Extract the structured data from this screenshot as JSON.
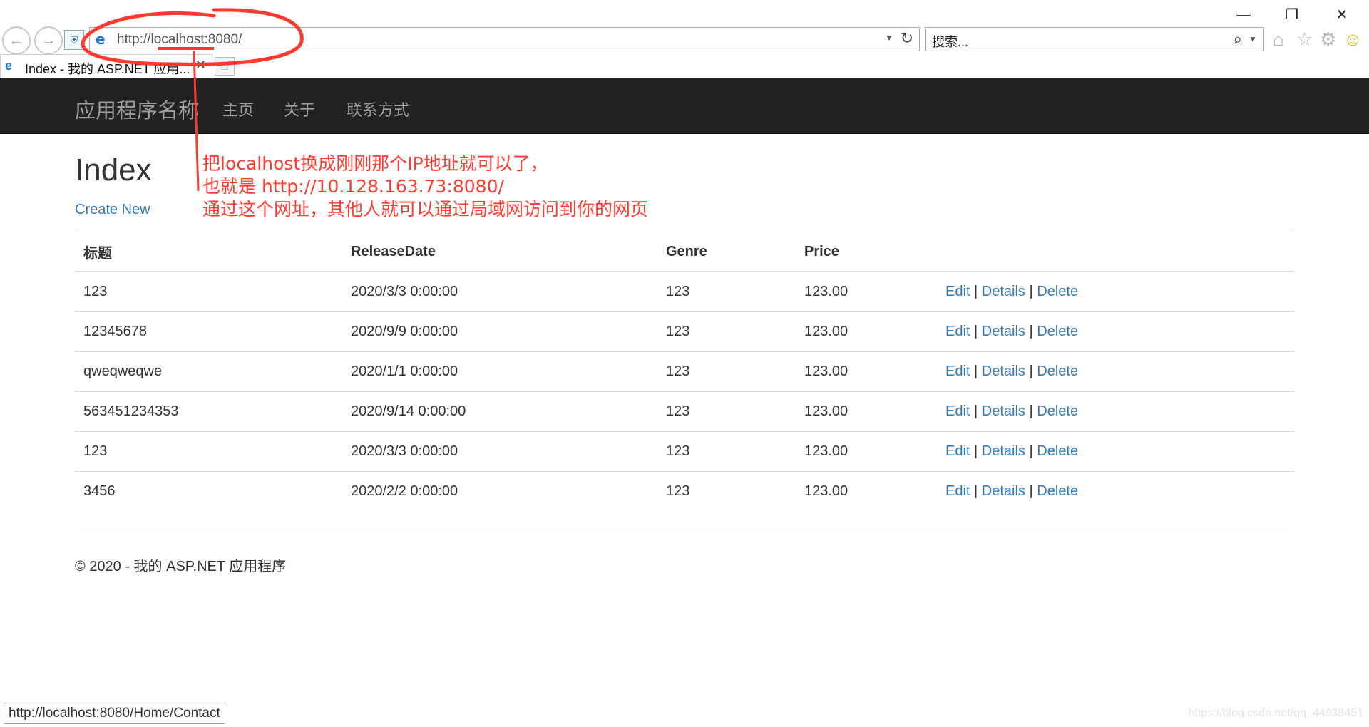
{
  "browser": {
    "window_controls": {
      "minimize": "—",
      "restore": "❐",
      "close": "✕"
    },
    "address": {
      "text": "http://localhost:8080/"
    },
    "search": {
      "placeholder": "搜索..."
    },
    "tab": {
      "title": "Index - 我的 ASP.NET 应用..."
    },
    "status_url": "http://localhost:8080/Home/Contact"
  },
  "site": {
    "brand": "应用程序名称",
    "nav": [
      "主页",
      "关于",
      "联系方式"
    ]
  },
  "page": {
    "title": "Index",
    "create_new": "Create New",
    "columns": [
      "标题",
      "ReleaseDate",
      "Genre",
      "Price"
    ],
    "rows": [
      {
        "title": "123",
        "release_date": "2020/3/3 0:00:00",
        "genre": "123",
        "price": "123.00"
      },
      {
        "title": "12345678",
        "release_date": "2020/9/9 0:00:00",
        "genre": "123",
        "price": "123.00"
      },
      {
        "title": "qweqweqwe",
        "release_date": "2020/1/1 0:00:00",
        "genre": "123",
        "price": "123.00"
      },
      {
        "title": "563451234353",
        "release_date": "2020/9/14 0:00:00",
        "genre": "123",
        "price": "123.00"
      },
      {
        "title": "123",
        "release_date": "2020/3/3 0:00:00",
        "genre": "123",
        "price": "123.00"
      },
      {
        "title": "3456",
        "release_date": "2020/2/2 0:00:00",
        "genre": "123",
        "price": "123.00"
      }
    ],
    "actions": {
      "edit": "Edit",
      "details": "Details",
      "delete": "Delete",
      "separator": "|"
    },
    "footer": "© 2020 - 我的 ASP.NET 应用程序"
  },
  "annotation": {
    "lines": [
      "把localhost换成刚刚那个IP地址就可以了，",
      "也就是  http://10.128.163.73:8080/",
      "通过这个网址，其他人就可以通过局域网访问到你的网页"
    ],
    "color": "#ff3b30"
  },
  "watermark": "https://blog.csdn.net/qq_44938451"
}
